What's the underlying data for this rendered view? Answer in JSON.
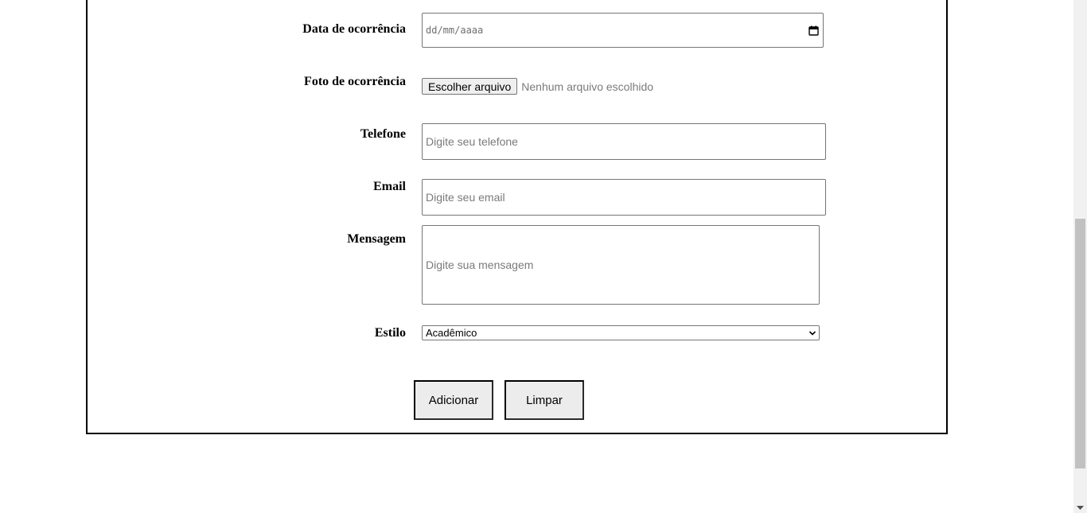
{
  "form": {
    "date": {
      "label": "Data de ocorrência",
      "placeholder": "dd/mm/aaaa"
    },
    "photo": {
      "label": "Foto de ocorrência",
      "button": "Escolher arquivo",
      "status": "Nenhum arquivo escolhido"
    },
    "phone": {
      "label": "Telefone",
      "placeholder": "Digite seu telefone"
    },
    "email": {
      "label": "Email",
      "placeholder": "Digite seu email"
    },
    "message": {
      "label": "Mensagem",
      "placeholder": "Digite sua mensagem"
    },
    "style": {
      "label": "Estilo",
      "selected": "Acadêmico"
    },
    "buttons": {
      "add": "Adicionar",
      "clear": "Limpar"
    }
  },
  "icons": {
    "date": "calendar-icon",
    "select": "chevron-down-icon",
    "scroll": "scroll-down-arrow-icon"
  },
  "colors": {
    "border": "#000000",
    "input_border": "#767676",
    "placeholder": "#7a7a7a",
    "button_bg": "#ececec"
  }
}
